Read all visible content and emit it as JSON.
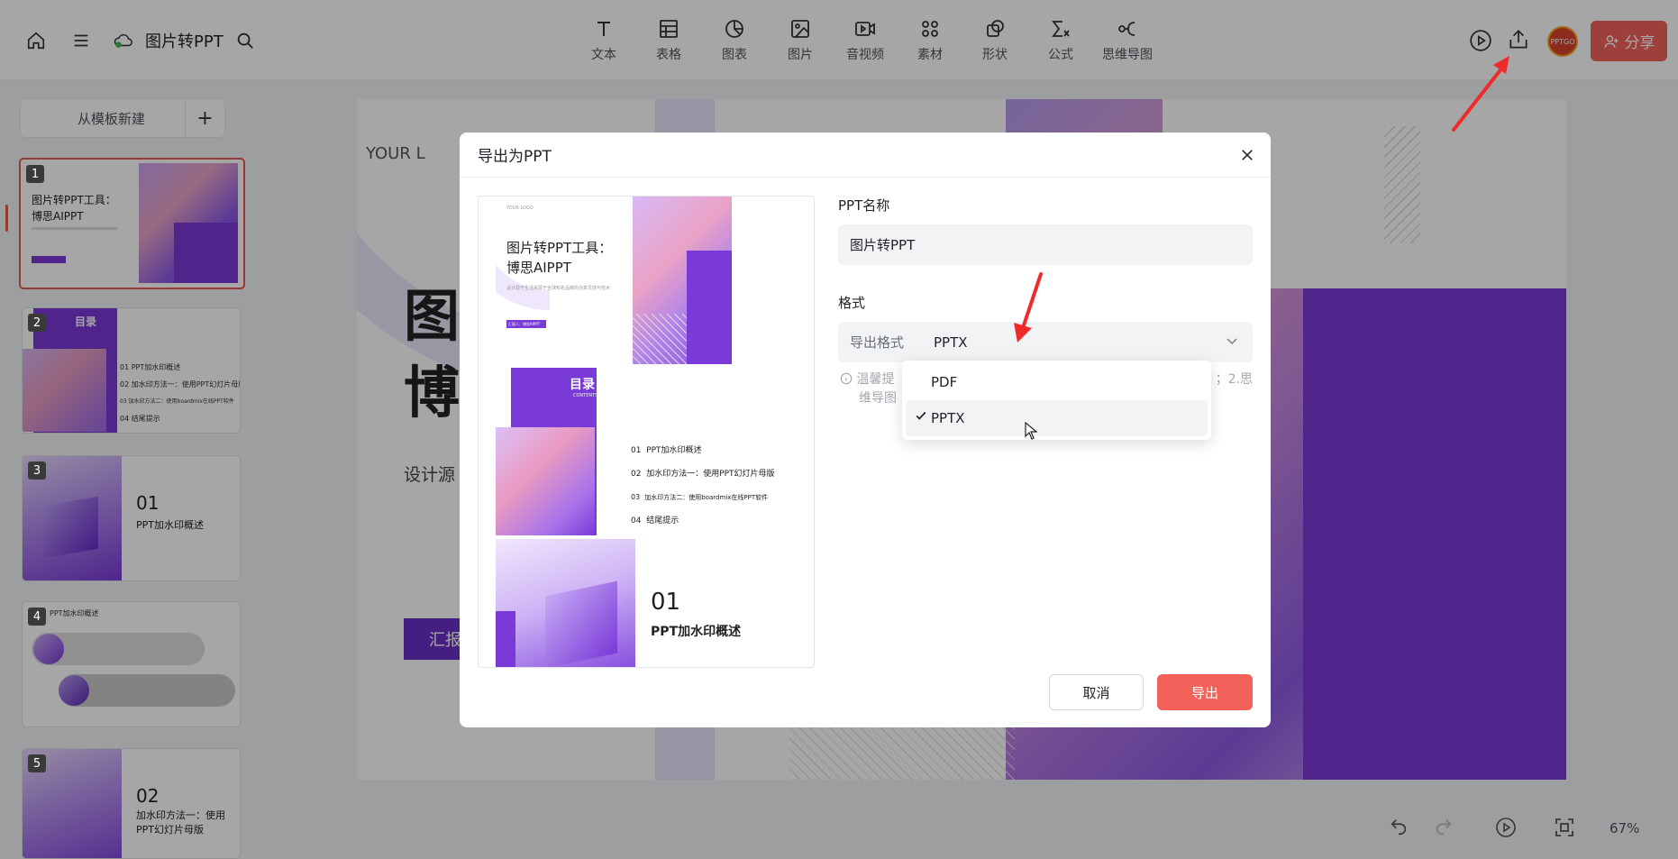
{
  "header": {
    "doc_title": "图片转PPT",
    "tools": [
      {
        "label": "文本",
        "icon": "text-icon"
      },
      {
        "label": "表格",
        "icon": "table-icon"
      },
      {
        "label": "图表",
        "icon": "chart-icon"
      },
      {
        "label": "图片",
        "icon": "image-icon"
      },
      {
        "label": "音视频",
        "icon": "video-icon"
      },
      {
        "label": "素材",
        "icon": "material-icon"
      },
      {
        "label": "形状",
        "icon": "shape-icon"
      },
      {
        "label": "公式",
        "icon": "formula-icon"
      },
      {
        "label": "思维导图",
        "icon": "mindmap-icon"
      }
    ],
    "avatar_text": "PPTGO",
    "share_label": "分享"
  },
  "sidebar": {
    "new_from_template": "从模板新建",
    "add_label": "+",
    "slides": [
      {
        "num": "1",
        "title": "图片转PPT工具：",
        "subtitle": "博思AIPPT"
      },
      {
        "num": "2",
        "title": "目录",
        "items": [
          "01 PPT加水印概述",
          "02 加水印方法一：使用PPT幻灯片母版",
          "03 加水印方法二：使用boardmix在线PPT软件",
          "04 结尾提示"
        ]
      },
      {
        "num": "3",
        "big": "01",
        "text": "PPT加水印概述"
      },
      {
        "num": "4",
        "text": "PPT加水印概述"
      },
      {
        "num": "5",
        "big": "02",
        "text": "加水印方法一：使用PPT幻灯片母版"
      }
    ]
  },
  "canvas": {
    "logo_text": "YOUR L",
    "title_line1": "图",
    "title_line2": "博",
    "subtitle": "设计源",
    "button_text": "汇报"
  },
  "modal": {
    "title": "导出为PPT",
    "name_label": "PPT名称",
    "name_value": "图片转PPT",
    "format_label": "格式",
    "format_prefix": "导出格式",
    "format_value": "PPTX",
    "hint": "温馨提示：1.导出后部分特殊效果可能会丢失；2.思维导图会以图片形式导出",
    "hint_visible_a": "温馨提",
    "hint_visible_b": "；2.思",
    "hint_visible_c": "维导图",
    "options": [
      "PDF",
      "PPTX"
    ],
    "selected_option": "PPTX",
    "cancel_label": "取消",
    "export_label": "导出",
    "preview": {
      "s1_logo": "YOUR LOGO",
      "s1_title1": "图片转PPT工具：",
      "s1_title2": "博思AIPPT",
      "s1_desc": "设计源于生活来源于全球知名品牌的创意灵感与技术",
      "s1_btn": "汇报人：博思AIPPT",
      "s2_title": "目录",
      "s2_sub": "CONTENTS",
      "s2_items": [
        {
          "n": "01",
          "t": "PPT加水印概述"
        },
        {
          "n": "02",
          "t": "加水印方法一：使用PPT幻灯片母版"
        },
        {
          "n": "03",
          "t": "加水印方法二：使用boardmix在线PPT软件"
        },
        {
          "n": "04",
          "t": "结尾提示"
        }
      ],
      "s3_num": "01",
      "s3_title": "PPT加水印概述"
    }
  },
  "footer": {
    "zoom": "67%"
  },
  "colors": {
    "accent": "#f2625a",
    "purple": "#7a3ad8",
    "active_border": "#e8594f"
  }
}
